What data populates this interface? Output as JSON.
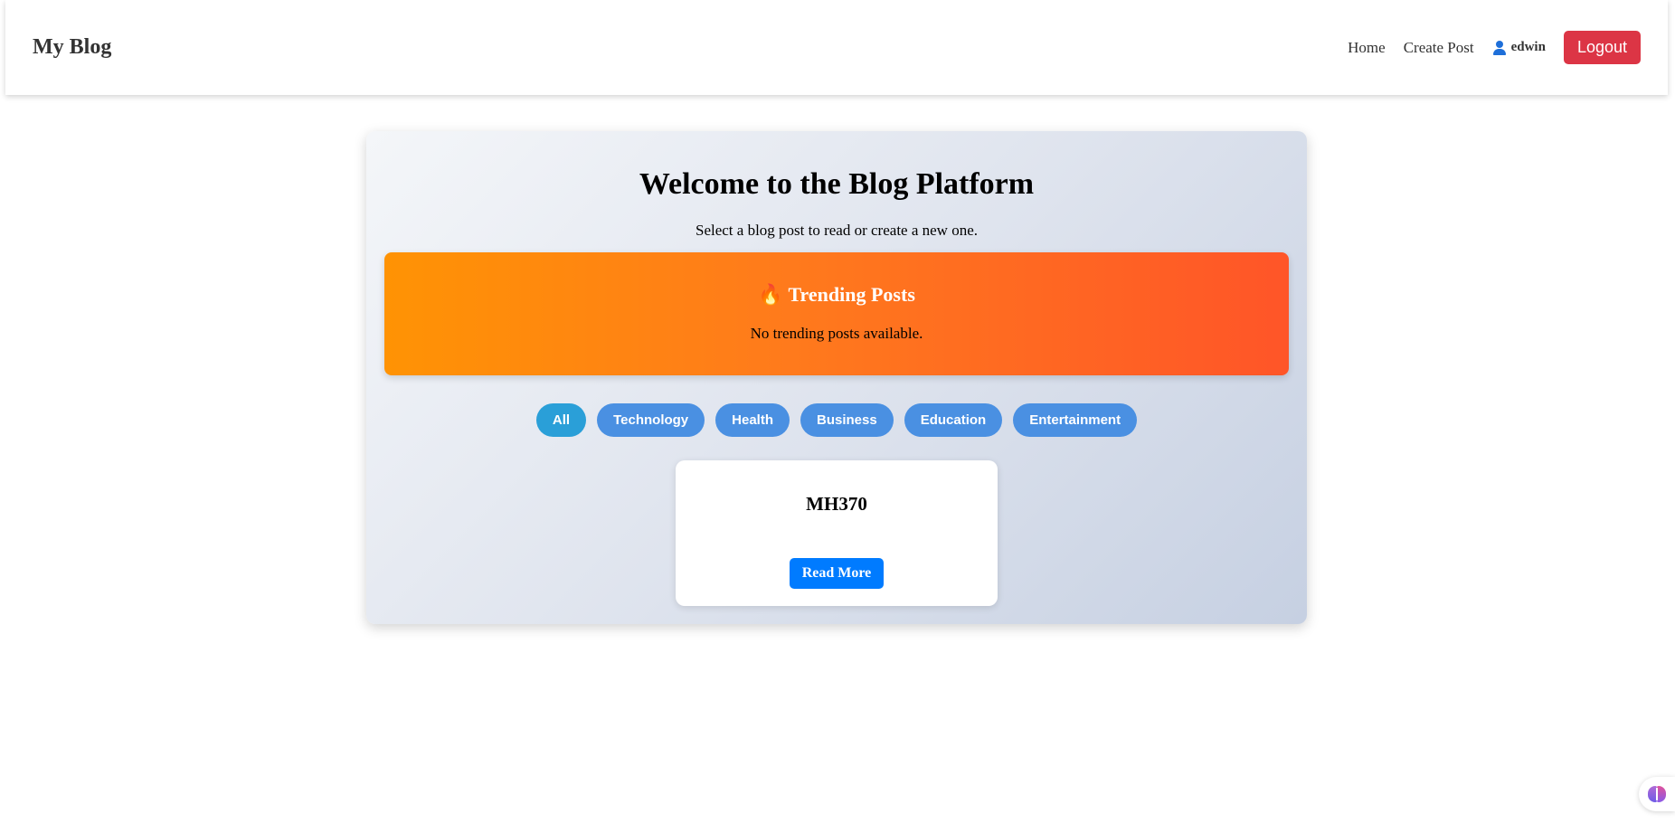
{
  "navbar": {
    "brand": "My Blog",
    "links": [
      "Home",
      "Create Post"
    ],
    "username": "edwin",
    "logout_label": "Logout"
  },
  "main": {
    "title": "Welcome to the Blog Platform",
    "subtitle": "Select a blog post to read or create a new one.",
    "trending": {
      "title": "Trending Posts",
      "icon": "fire-icon",
      "empty_text": "No trending posts available."
    },
    "categories": [
      "All",
      "Technology",
      "Health",
      "Business",
      "Education",
      "Entertainment"
    ],
    "active_category": "All",
    "posts": [
      {
        "title": "MH370",
        "button_label": "Read More"
      }
    ]
  },
  "colors": {
    "logout": "#dc3545",
    "filter": "#4a90e2",
    "filter_active": "#2a9fd8",
    "read_more": "#007bff",
    "trending_start": "#ff9304",
    "trending_end": "#ff5528"
  },
  "widgets": {
    "assistant_icon": "brain-icon"
  }
}
